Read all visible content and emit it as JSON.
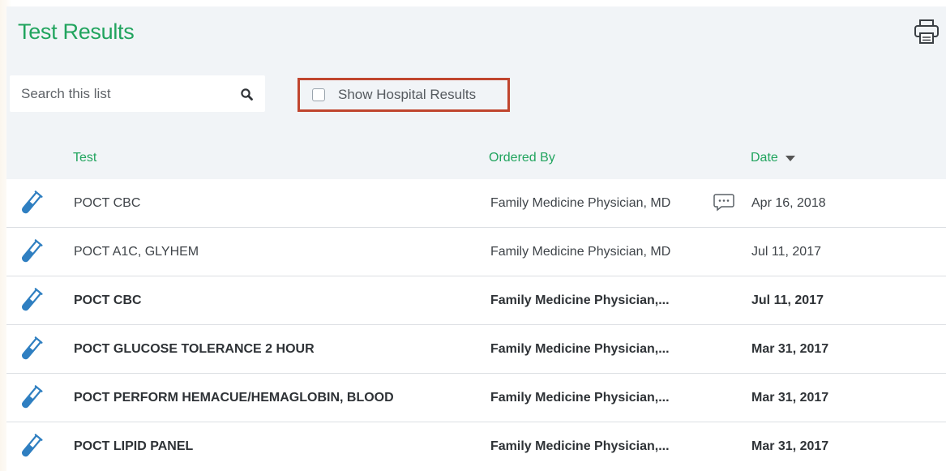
{
  "header": {
    "title": "Test Results",
    "print_icon": "printer-icon"
  },
  "toolbar": {
    "search": {
      "placeholder": "Search this list",
      "value": "",
      "icon": "search-icon"
    },
    "hospital_toggle": {
      "label": "Show Hospital Results",
      "checked": false,
      "highlight_color": "#c0452e"
    }
  },
  "table": {
    "headers": {
      "test": "Test",
      "ordered_by": "Ordered By",
      "date": "Date"
    },
    "sort": {
      "column": "date",
      "direction": "descending"
    },
    "rows": [
      {
        "test": "POCT CBC",
        "ordered_by": "Family Medicine Physician, MD",
        "date": "Apr 16, 2018",
        "unread": false,
        "has_comment": true,
        "icon": "test-tube-icon"
      },
      {
        "test": "POCT A1C, GLYHEM",
        "ordered_by": "Family Medicine Physician, MD",
        "date": "Jul 11, 2017",
        "unread": false,
        "has_comment": false,
        "icon": "test-tube-icon"
      },
      {
        "test": "POCT CBC",
        "ordered_by": "Family Medicine Physician,...",
        "date": "Jul 11, 2017",
        "unread": true,
        "has_comment": false,
        "icon": "test-tube-icon"
      },
      {
        "test": "POCT GLUCOSE TOLERANCE 2 HOUR",
        "ordered_by": "Family Medicine Physician,...",
        "date": "Mar 31, 2017",
        "unread": true,
        "has_comment": false,
        "icon": "test-tube-icon"
      },
      {
        "test": "POCT PERFORM HEMACUE/HEMAGLOBIN, BLOOD",
        "ordered_by": "Family Medicine Physician,...",
        "date": "Mar 31, 2017",
        "unread": true,
        "has_comment": false,
        "icon": "test-tube-icon"
      },
      {
        "test": "POCT LIPID PANEL",
        "ordered_by": "Family Medicine Physician,...",
        "date": "Mar 31, 2017",
        "unread": true,
        "has_comment": false,
        "icon": "test-tube-icon"
      }
    ]
  },
  "colors": {
    "accent_green": "#21a45e",
    "test_tube_blue": "#2f7fc1",
    "panel_background": "#f1f4f7"
  }
}
